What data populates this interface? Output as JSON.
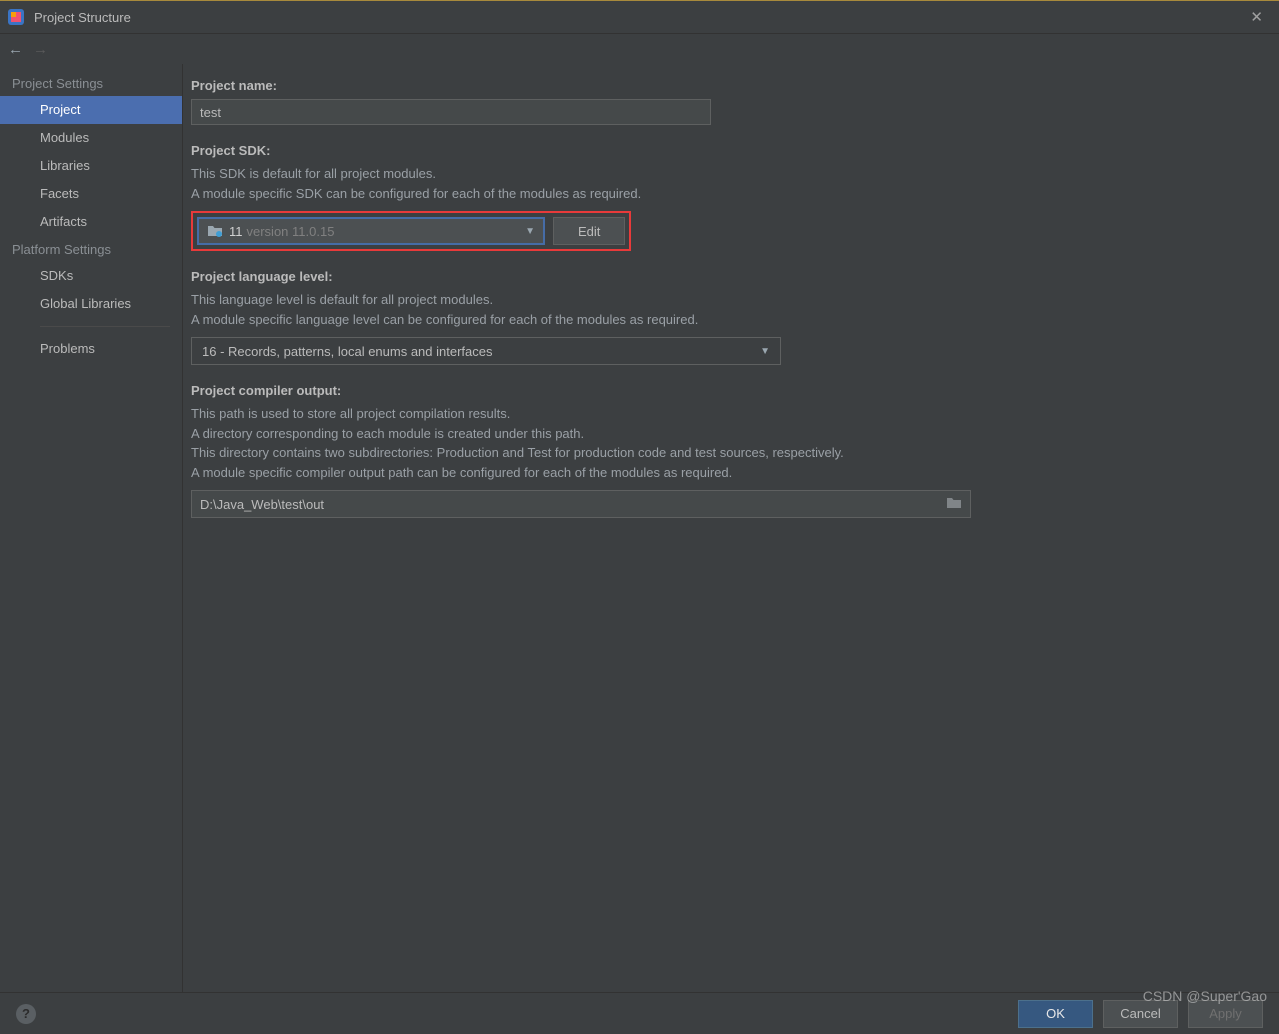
{
  "titlebar": {
    "title": "Project Structure"
  },
  "sidebar": {
    "heading_project": "Project Settings",
    "heading_platform": "Platform Settings",
    "items_project": [
      {
        "label": "Project",
        "selected": true
      },
      {
        "label": "Modules"
      },
      {
        "label": "Libraries"
      },
      {
        "label": "Facets"
      },
      {
        "label": "Artifacts"
      }
    ],
    "items_platform": [
      {
        "label": "SDKs"
      },
      {
        "label": "Global Libraries"
      }
    ],
    "items_extra": [
      {
        "label": "Problems"
      }
    ]
  },
  "project_name": {
    "label": "Project name:",
    "value": "test"
  },
  "project_sdk": {
    "label": "Project SDK:",
    "desc1": "This SDK is default for all project modules.",
    "desc2": "A module specific SDK can be configured for each of the modules as required.",
    "selected_name": "11",
    "selected_version": "version 11.0.15",
    "edit_label": "Edit"
  },
  "language_level": {
    "label": "Project language level:",
    "desc1": "This language level is default for all project modules.",
    "desc2": "A module specific language level can be configured for each of the modules as required.",
    "selected": "16 - Records, patterns, local enums and interfaces"
  },
  "compiler_output": {
    "label": "Project compiler output:",
    "desc1": "This path is used to store all project compilation results.",
    "desc2": "A directory corresponding to each module is created under this path.",
    "desc3": "This directory contains two subdirectories: Production and Test for production code and test sources, respectively.",
    "desc4": "A module specific compiler output path can be configured for each of the modules as required.",
    "value": "D:\\Java_Web\\test\\out"
  },
  "footer": {
    "ok": "OK",
    "cancel": "Cancel",
    "apply": "Apply"
  },
  "watermark": "CSDN @Super'Gao"
}
